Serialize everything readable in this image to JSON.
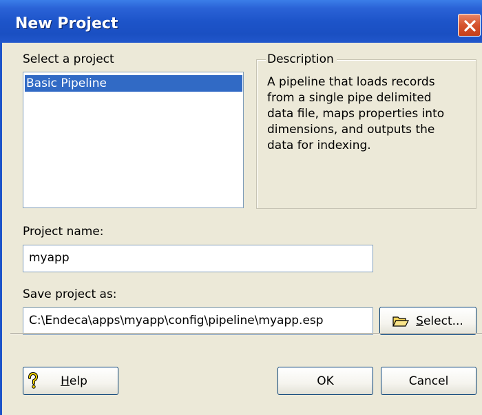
{
  "window": {
    "title": "New Project"
  },
  "project_list": {
    "label": "Select a project",
    "items": [
      "Basic Pipeline"
    ],
    "selected": "Basic Pipeline"
  },
  "description": {
    "legend": "Description",
    "lines": [
      "A pipeline that loads records",
      "from a single pipe delimited",
      "data file, maps properties into",
      "dimensions, and outputs the",
      "data for indexing."
    ]
  },
  "project_name": {
    "label": "Project name:",
    "value": "myapp"
  },
  "save_as": {
    "label": "Save project as:",
    "value": "C:\\Endeca\\apps\\myapp\\config\\pipeline\\myapp.esp",
    "select_button": {
      "mnemonic": "S",
      "rest": "elect..."
    }
  },
  "buttons": {
    "help": {
      "mnemonic": "H",
      "rest": "elp"
    },
    "ok": "OK",
    "cancel": "Cancel"
  },
  "icons": {
    "close": "close-icon",
    "folder": "open-folder-icon",
    "help": "help-question-icon"
  },
  "colors": {
    "titlebar": "#1d54c9",
    "close": "#d5532e",
    "selection": "#316ac5",
    "dialog_bg": "#ece9d8"
  }
}
